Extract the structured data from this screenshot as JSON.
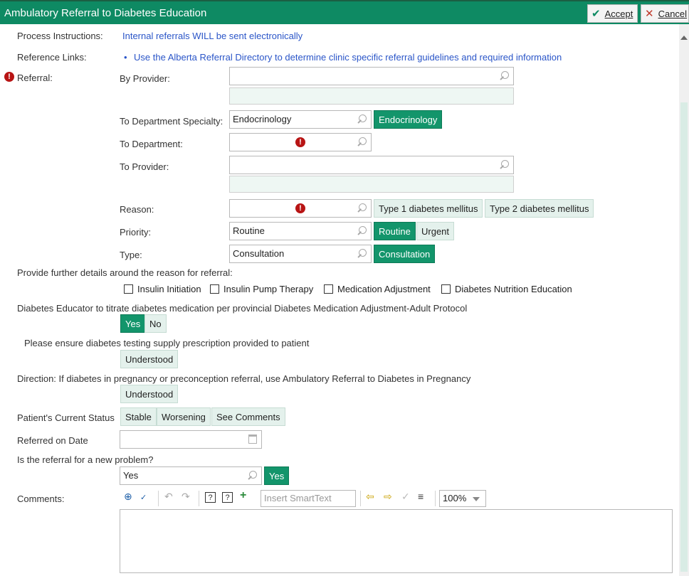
{
  "window": {
    "title": "Ambulatory Referral to Diabetes Education",
    "accept_label": "Accept",
    "cancel_label": "Cancel"
  },
  "process_instructions": {
    "label": "Process Instructions:",
    "text": "Internal referrals WILL be sent electronically"
  },
  "reference_links": {
    "label": "Reference Links:",
    "bullet": "•",
    "link": "Use the Alberta Referral Directory to determine clinic specific referral guidelines and required information"
  },
  "referral": {
    "label": "Referral:",
    "by_provider": {
      "label": "By Provider:",
      "value": ""
    },
    "to_department_specialty": {
      "label": "To Department Specialty:",
      "value": "Endocrinology",
      "option": "Endocrinology"
    },
    "to_department": {
      "label": "To Department:",
      "value": ""
    },
    "to_provider": {
      "label": "To Provider:",
      "value": ""
    },
    "reason": {
      "label": "Reason:",
      "value": "",
      "options": [
        "Type 1 diabetes mellitus",
        "Type 2 diabetes mellitus"
      ]
    },
    "priority": {
      "label": "Priority:",
      "value": "Routine",
      "options": [
        "Routine",
        "Urgent"
      ],
      "selected": "Routine"
    },
    "type": {
      "label": "Type:",
      "value": "Consultation",
      "option": "Consultation"
    }
  },
  "further_details": {
    "label": "Provide further details around the reason for referral:",
    "options": [
      "Insulin Initiation",
      "Insulin Pump Therapy",
      "Medication Adjustment",
      "Diabetes Nutrition Education"
    ]
  },
  "titrate": {
    "label": "Diabetes Educator to titrate diabetes medication per provincial Diabetes Medication Adjustment-Adult Protocol",
    "options": [
      "Yes",
      "No"
    ],
    "selected": "Yes"
  },
  "supply": {
    "label": "Please ensure diabetes testing supply prescription provided to patient",
    "option": "Understood"
  },
  "direction": {
    "label": "Direction: If diabetes in pregnancy or preconception referral, use Ambulatory Referral to Diabetes in Pregnancy",
    "option": "Understood"
  },
  "status": {
    "label": "Patient's Current Status",
    "options": [
      "Stable",
      "Worsening",
      "See Comments"
    ]
  },
  "referred_date": {
    "label": "Referred on Date",
    "value": ""
  },
  "new_problem": {
    "label": "Is the referral for a new problem?",
    "value": "Yes",
    "option": "Yes"
  },
  "comments": {
    "label": "Comments:",
    "smarttext_placeholder": "Insert SmartText",
    "zoom": "100%"
  },
  "colors": {
    "header": "#0e8a63",
    "selected_pill": "#13956b",
    "pill": "#e4f1ec",
    "link": "#2a55c8",
    "required": "#b81414"
  }
}
